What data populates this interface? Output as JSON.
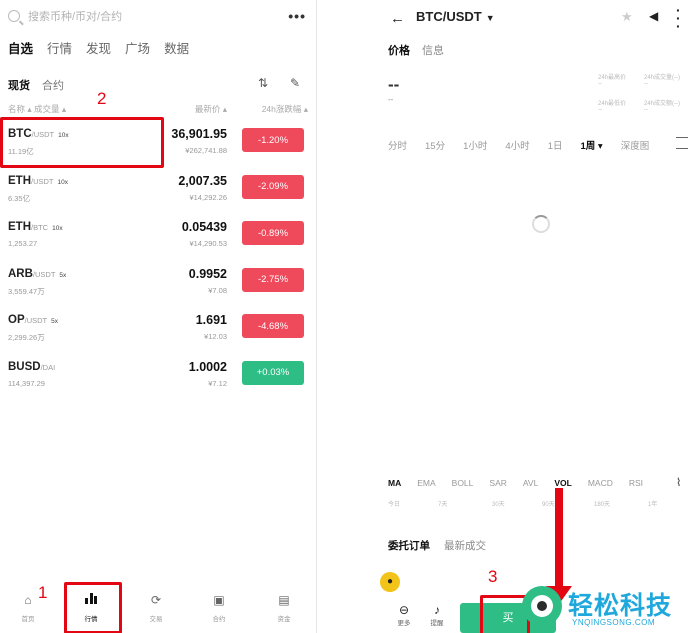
{
  "left": {
    "search_placeholder": "搜索币种/币对/合约",
    "more_label": "•••",
    "main_tabs": [
      {
        "label": "自选",
        "active": true
      },
      {
        "label": "行情",
        "active": false
      },
      {
        "label": "发现",
        "active": false
      },
      {
        "label": "广场",
        "active": false
      },
      {
        "label": "数据",
        "active": false
      }
    ],
    "sub_tabs": [
      {
        "label": "现货",
        "active": true
      },
      {
        "label": "合约",
        "active": false
      }
    ],
    "col_name": "名称 ▴ 成交量 ▴",
    "col_price": "最新价 ▴",
    "col_change": "24h涨跌幅 ▴",
    "rows": [
      {
        "base": "BTC",
        "quote": "/USDT",
        "leverage": "10x",
        "volume": "11.19亿",
        "price": "36,901.95",
        "cny": "¥262,741.88",
        "change": "-1.20%",
        "dir": "down"
      },
      {
        "base": "ETH",
        "quote": "/USDT",
        "leverage": "10x",
        "volume": "6.35亿",
        "price": "2,007.35",
        "cny": "¥14,292.26",
        "change": "-2.09%",
        "dir": "down"
      },
      {
        "base": "ETH",
        "quote": "/BTC",
        "leverage": "10x",
        "volume": "1,253.27",
        "price": "0.05439",
        "cny": "¥14,290.53",
        "change": "-0.89%",
        "dir": "down"
      },
      {
        "base": "ARB",
        "quote": "/USDT",
        "leverage": "5x",
        "volume": "3,559.47万",
        "price": "0.9952",
        "cny": "¥7.08",
        "change": "-2.75%",
        "dir": "down"
      },
      {
        "base": "OP",
        "quote": "/USDT",
        "leverage": "5x",
        "volume": "2,299.26万",
        "price": "1.691",
        "cny": "¥12.03",
        "change": "-4.68%",
        "dir": "down"
      },
      {
        "base": "BUSD",
        "quote": "/DAI",
        "leverage": "",
        "volume": "114,397.29",
        "price": "1.0002",
        "cny": "¥7.12",
        "change": "+0.03%",
        "dir": "up"
      }
    ],
    "bottom_nav": [
      {
        "label": "首页",
        "icon": "home-icon"
      },
      {
        "label": "行情",
        "icon": "bar-chart-icon",
        "active": true
      },
      {
        "label": "交易",
        "icon": "trade-icon"
      },
      {
        "label": "合约",
        "icon": "contract-icon"
      },
      {
        "label": "资金",
        "icon": "wallet-icon"
      }
    ],
    "step1": "1",
    "step2": "2"
  },
  "right": {
    "pair": "BTC/USDT",
    "tabs": [
      {
        "label": "价格",
        "active": true
      },
      {
        "label": "信息",
        "active": false
      }
    ],
    "last_price": "--",
    "sub_price": "--",
    "stats": [
      {
        "label": "24h最高价",
        "value": "--"
      },
      {
        "label": "24h成交量(--)",
        "value": "--"
      },
      {
        "label": "24h最低价",
        "value": "--"
      },
      {
        "label": "24h成交额(--)",
        "value": "--"
      }
    ],
    "timeframes": [
      {
        "label": "分时",
        "active": false
      },
      {
        "label": "15分",
        "active": false
      },
      {
        "label": "1小时",
        "active": false
      },
      {
        "label": "4小时",
        "active": false
      },
      {
        "label": "1日",
        "active": false
      },
      {
        "label": "1周 ▾",
        "active": true
      },
      {
        "label": "深度图",
        "active": false
      }
    ],
    "indicators": [
      {
        "label": "MA",
        "active": true
      },
      {
        "label": "EMA",
        "active": false
      },
      {
        "label": "BOLL",
        "active": false
      },
      {
        "label": "SAR",
        "active": false
      },
      {
        "label": "AVL",
        "active": false
      },
      {
        "label": "VOL",
        "active": true
      },
      {
        "label": "MACD",
        "active": false
      },
      {
        "label": "RSI",
        "active": false
      }
    ],
    "indicator_row": [
      "今日",
      "7天",
      "30天",
      "90天",
      "180天",
      "1年"
    ],
    "order_tabs": [
      {
        "label": "委托订单",
        "active": true
      },
      {
        "label": "最新成交",
        "active": false
      }
    ],
    "bottom": [
      {
        "label": "更多",
        "icon": "more-icon"
      },
      {
        "label": "提醒",
        "icon": "bell-icon"
      }
    ],
    "buy_label": "买",
    "step3": "3"
  },
  "watermark": {
    "name": "轻松科技",
    "site": "YNQINGSONG.COM"
  },
  "colors": {
    "down": "#ee4a5c",
    "up": "#2ebd85",
    "highlight": "#e30613",
    "watermark": "#1fa8dc"
  }
}
